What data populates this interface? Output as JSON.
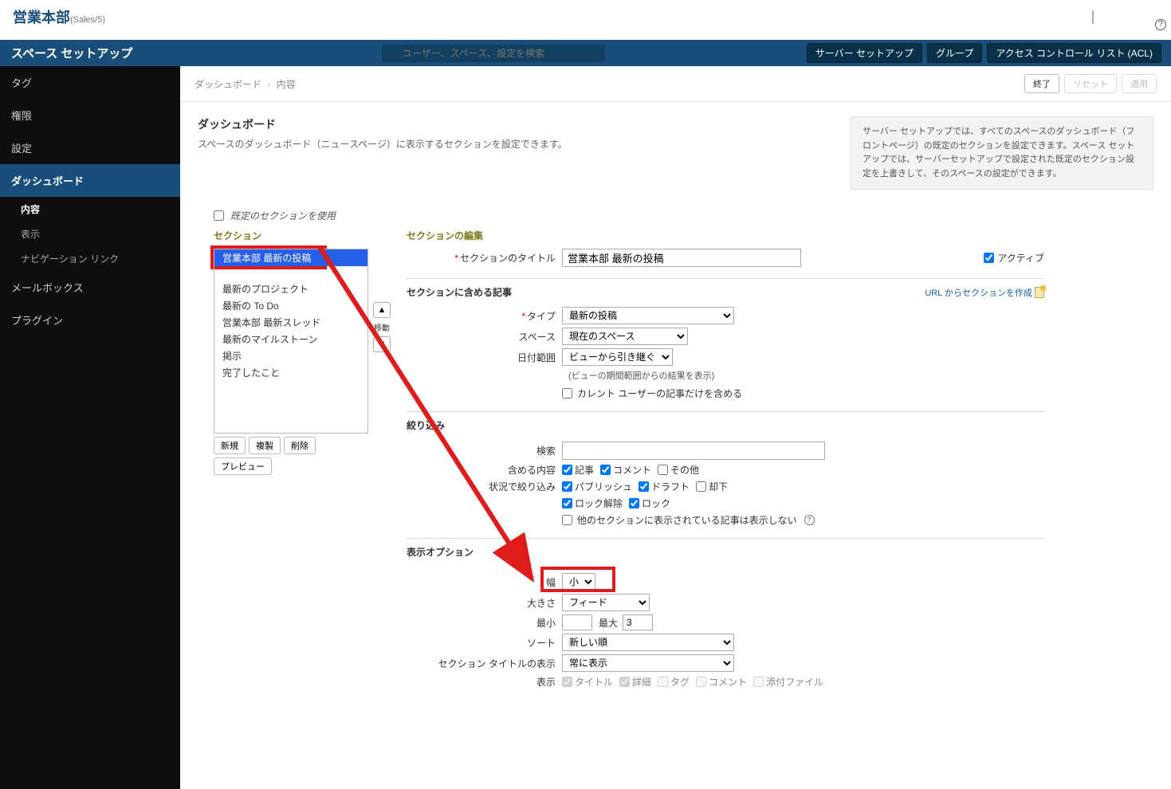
{
  "header": {
    "titleMain": "営業本部",
    "titleSub": "(Sales/5)",
    "helpGlyph": "?"
  },
  "topbar": {
    "sidebarTitle": "スペース セットアップ",
    "searchPlaceholder": "ユーザー、スペース、設定を検索",
    "buttons": {
      "serverSetup": "サーバー セットアップ",
      "group": "グループ",
      "acl": "アクセス コントロール リスト (ACL)"
    }
  },
  "sidebar": {
    "items": [
      {
        "label": "タグ",
        "active": false
      },
      {
        "label": "権限",
        "active": false
      },
      {
        "label": "設定",
        "active": false
      },
      {
        "label": "ダッシュボード",
        "active": true
      },
      {
        "label": "メールボックス",
        "active": false
      },
      {
        "label": "プラグイン",
        "active": false
      }
    ],
    "subItems": [
      {
        "label": "内容",
        "active": true
      },
      {
        "label": "表示",
        "active": false
      },
      {
        "label": "ナビゲーション リンク",
        "active": false
      }
    ]
  },
  "breadcrumb": {
    "parent": "ダッシュボード",
    "current": "内容"
  },
  "actions": {
    "exit": "終了",
    "reset": "リセット",
    "apply": "適用"
  },
  "main": {
    "title": "ダッシュボード",
    "desc": "スペースのダッシュボード（ニュースページ）に表示するセクションを設定できます。",
    "info": "サーバー セットアップでは、すべてのスペースのダッシュボード（フロントページ）の既定のセクションを設定できます。スペース セットアップでは、サーバーセットアップで設定された既定のセクション設定を上書きして、そのスペースの設定ができます。",
    "useDefault": "既定のセクションを使用"
  },
  "sectionsCol": {
    "header": "セクション",
    "items": [
      "営業本部 最新の投稿",
      "最新のプロジェクト",
      "最新の To Do",
      "営業本部 最新スレッド",
      "最新のマイルストーン",
      "掲示",
      "完了したこと"
    ],
    "selectedIndex": 0,
    "buttons": {
      "new": "新規",
      "dup": "複製",
      "del": "削除",
      "preview": "プレビュー"
    },
    "moveLabel": "移動",
    "upGlyph": "▲",
    "downGlyph": "▼"
  },
  "editCol": {
    "header": "セクションの編集",
    "titleLabel": "セクションのタイトル",
    "titleValue": "営業本部 最新の投稿",
    "activeLabel": "アクティブ",
    "articlesHeader": "セクションに含める記事",
    "urlLink": "URL からセクションを作成",
    "typeLabel": "タイプ",
    "typeValue": "最新の投稿",
    "spaceLabel": "スペース",
    "spaceValue": "現在のスペース",
    "dateRangeLabel": "日付範囲",
    "dateRangeValue": "ビューから引き継ぐ",
    "dateRangeHint": "(ビューの期間範囲からの結果を表示)",
    "currentUserOnly": "カレント ユーザーの記事だけを含める",
    "filterHeader": "絞り込み",
    "searchLabel": "検索",
    "includeLabel": "含める内容",
    "includeArticles": "記事",
    "includeComments": "コメント",
    "includeOther": "その他",
    "statusFilterLabel": "状況で絞り込み",
    "statusPublish": "パブリッシュ",
    "statusDraft": "ドラフト",
    "statusReject": "却下",
    "statusUnlocked": "ロック解除",
    "statusLocked": "ロック",
    "excludeOtherSections": "他のセクションに表示されている記事は表示しない",
    "displayHeader": "表示オプション",
    "widthLabel": "幅",
    "widthValue": "小",
    "sizeLabel": "大きさ",
    "sizeValue": "フィード",
    "minLabel": "最小",
    "minValue": "",
    "maxLabel": "最大",
    "maxValue": "3",
    "sortLabel": "ソート",
    "sortValue": "新しい順",
    "sectionTitleDisplayLabel": "セクション タイトルの表示",
    "sectionTitleDisplayValue": "常に表示",
    "displayLabel": "表示",
    "dispTitle": "タイトル",
    "dispDetail": "詳細",
    "dispTag": "タグ",
    "dispComment": "コメント",
    "dispAttachment": "添付ファイル"
  }
}
